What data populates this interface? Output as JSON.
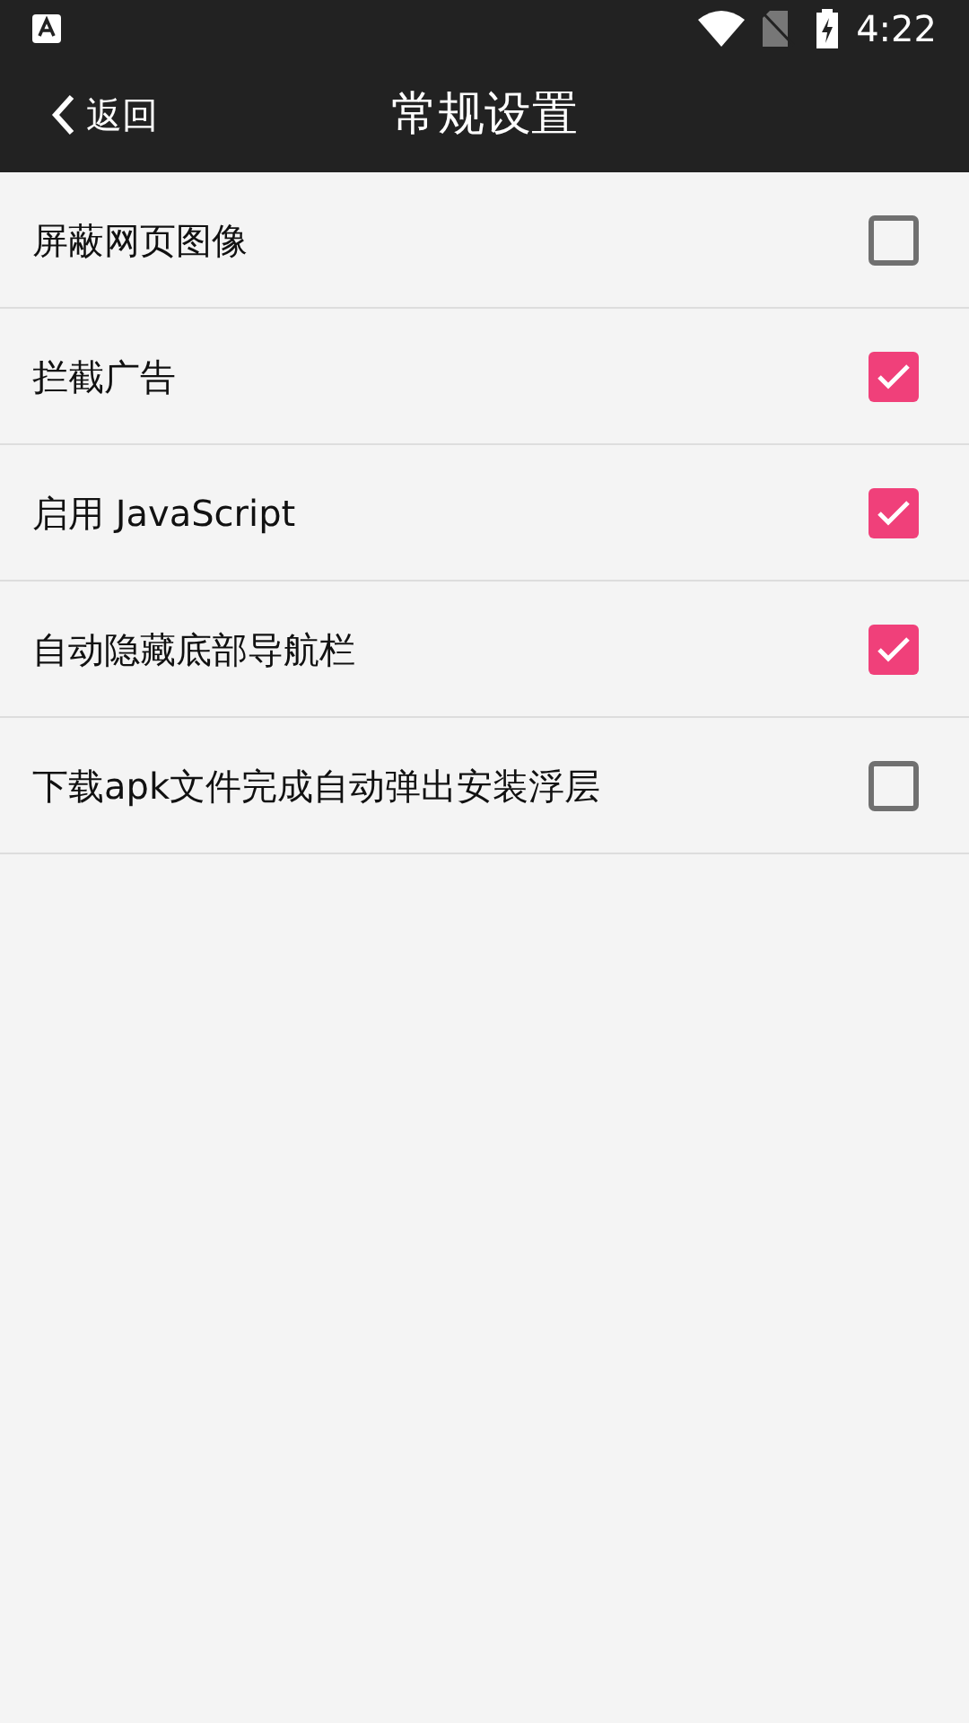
{
  "status_bar": {
    "time": "4:22"
  },
  "app_bar": {
    "back": "返回",
    "title": "常规设置"
  },
  "settings": [
    {
      "label": "屏蔽网页图像",
      "checked": false
    },
    {
      "label": "拦截广告",
      "checked": true
    },
    {
      "label": "启用 JavaScript",
      "checked": true
    },
    {
      "label": "自动隐藏底部导航栏",
      "checked": true
    },
    {
      "label": "下载apk文件完成自动弹出安装浮层",
      "checked": false
    }
  ]
}
